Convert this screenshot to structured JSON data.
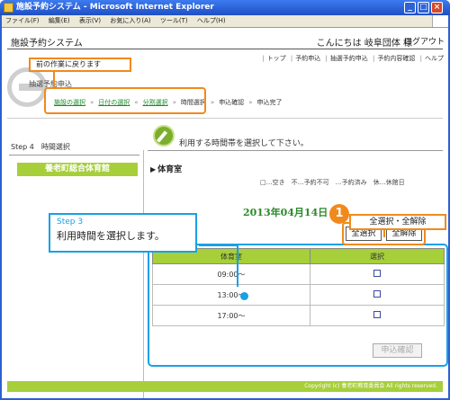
{
  "window": {
    "title": "施設予約システム - Microsoft Internet Explorer"
  },
  "menu": [
    "ファイル(F)",
    "編集(E)",
    "表示(V)",
    "お気に入り(A)",
    "ツール(T)",
    "ヘルプ(H)"
  ],
  "header": {
    "title": "施設予約システム",
    "greeting": "こんにちは 岐阜団体 様",
    "logout": "ログアウト"
  },
  "topnav": [
    "トップ",
    "予約申込",
    "抽選予約申込",
    "予約内容確認",
    "ヘルプ"
  ],
  "process_label": "抽選予約申込",
  "breadcrumb": [
    "施設の選択",
    "日付の選択",
    "分割選択",
    "時間選択",
    "申込確認",
    "申込完了"
  ],
  "sidebar": {
    "step": "Step 4　時間選択",
    "facility": "養老町総合体育館"
  },
  "main": {
    "instruction": "利用する時間帯を選択して下さい。",
    "room": "体育室",
    "legend": "□…空き　不…予約不可　…予約済み　休…休館日",
    "date": "2013年04月14日",
    "select_all": "全選択",
    "clear_all": "全解除",
    "table": {
      "headers": [
        "体育室",
        "選択"
      ],
      "rows": [
        {
          "time": "09:00～"
        },
        {
          "time": "13:00～"
        },
        {
          "time": "17:00～"
        }
      ]
    },
    "confirm": "申込確認"
  },
  "footer": "Copyright (c) 養老町教育委員会 All rights reserved.",
  "annotations": {
    "back": "前の作業に戻ります",
    "step_title": "Step 3",
    "step_text": "利用時間を選択します。",
    "number": "1",
    "select_toggle": "全選択・全解除"
  },
  "colors": {
    "accent_green": "#a6cf3a",
    "annotation_orange": "#f08a1c",
    "annotation_blue": "#19a0e6",
    "title_blue": "#2f5fd0"
  }
}
